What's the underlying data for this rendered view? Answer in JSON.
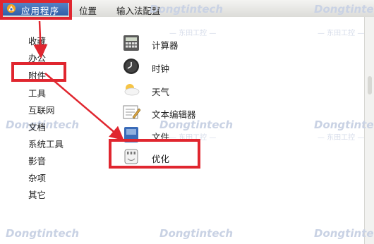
{
  "topbar": {
    "app_menu": "应用程序",
    "places_menu": "位置",
    "input_method_menu": "输入法配置"
  },
  "categories": [
    "收藏",
    "办公",
    "附件",
    "工具",
    "互联网",
    "文档",
    "系统工具",
    "影音",
    "杂项",
    "其它"
  ],
  "apps": [
    {
      "label": "计算器",
      "icon": "calculator-icon"
    },
    {
      "label": "时钟",
      "icon": "clock-icon"
    },
    {
      "label": "天气",
      "icon": "weather-icon"
    },
    {
      "label": "文本编辑器",
      "icon": "text-editor-icon"
    },
    {
      "label": "文件",
      "icon": "file-icon"
    },
    {
      "label": "优化",
      "icon": "optimize-icon"
    }
  ],
  "watermark": {
    "brand": "Dongtintech",
    "sub": "— 东田工控 —"
  },
  "colors": {
    "highlight": "#e0262f",
    "menu_active": "#3a68b0"
  }
}
